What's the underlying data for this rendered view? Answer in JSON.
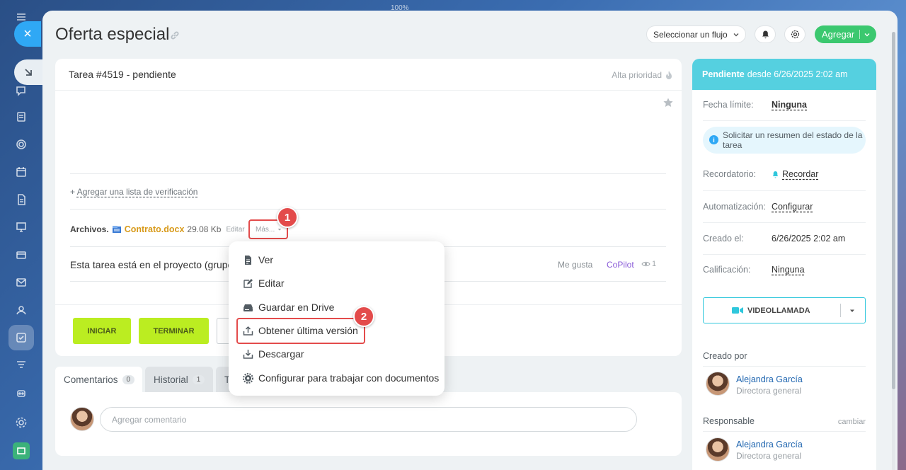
{
  "zoom": "100%",
  "page": {
    "title": "Oferta especial"
  },
  "toolbar": {
    "flow_select": "Seleccionar un flujo",
    "add_label": "Agregar"
  },
  "task": {
    "header": "Tarea #4519 - pendiente",
    "priority": "Alta prioridad",
    "checklist_plus": "+ ",
    "checklist_link": "Agregar una lista de verificación",
    "files_label": "Archivos.",
    "file_name": "Contrato.docx",
    "file_size": "29.08 Kb",
    "file_edit": "Editar",
    "file_more": "Más...",
    "project_text": "Esta tarea está en el proyecto (grupo",
    "like": "Me gusta",
    "copilot": "CoPilot",
    "views": "1",
    "buttons": {
      "start": "INICIAR",
      "finish": "TERMINAR"
    }
  },
  "annotations": {
    "badge1": "1",
    "badge2": "2"
  },
  "context_menu": {
    "items": [
      "Ver",
      "Editar",
      "Guardar en Drive",
      "Obtener última versión",
      "Descargar",
      "Configurar para trabajar con documentos"
    ]
  },
  "tabs": [
    {
      "label": "Comentarios",
      "count": "0"
    },
    {
      "label": "Historial",
      "count": "1"
    },
    {
      "label": "T",
      "count": ""
    }
  ],
  "comment": {
    "placeholder": "Agregar comentario"
  },
  "sidebar": {
    "status_bold": "Pendiente",
    "status_rest": "desde 6/26/2025 2:02 am",
    "deadline_label": "Fecha límite:",
    "deadline_value": "Ninguna",
    "hint": "Solicitar un resumen del estado de la tarea",
    "reminder_label": "Recordatorio:",
    "reminder_value": "Recordar",
    "automation_label": "Automatización:",
    "automation_value": "Configurar",
    "created_label": "Creado el:",
    "created_value": "6/26/2025 2:02 am",
    "rating_label": "Calificación:",
    "rating_value": "Ninguna",
    "video_label": "VIDEOLLAMADA",
    "created_by_title": "Creado por",
    "creator_name": "Alejandra García",
    "creator_role": "Directora general",
    "responsible_title": "Responsable",
    "responsible_change": "cambiar",
    "responsible_name": "Alejandra García",
    "responsible_role": "Directora general"
  },
  "colors": {
    "accent_green": "#3bc86f",
    "status_cyan": "#55d0e0",
    "lime": "#bbed21",
    "highlight_red": "#e34b4b"
  }
}
